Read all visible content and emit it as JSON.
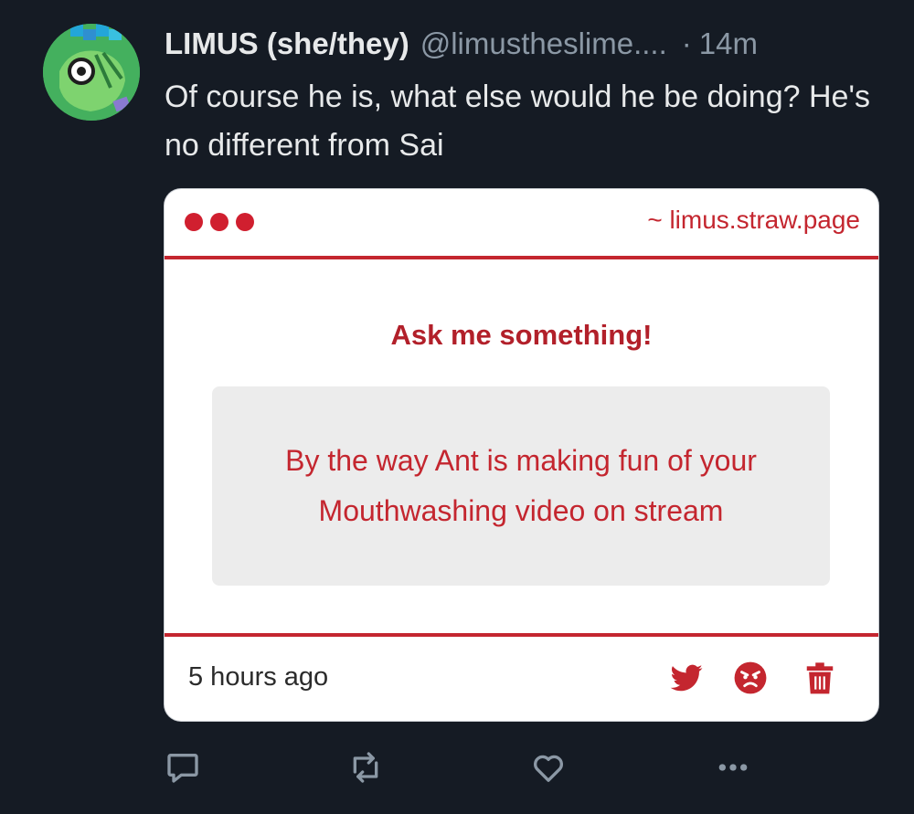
{
  "tweet": {
    "author_name": "LIMUS (she/they)",
    "handle": "@limustheslime....",
    "separator": "·",
    "time": "14m",
    "text": "Of course he is, what else would he be doing? He's no different from Sai"
  },
  "card": {
    "site": "~ limus.straw.page",
    "heading": "Ask me something!",
    "question": "By the way Ant is making fun of your Mouthwashing video on stream",
    "timestamp": "5 hours ago",
    "icons": [
      "twitter-icon",
      "angry-face-icon",
      "trash-icon"
    ],
    "accent_color": "#c4262f"
  },
  "actions": [
    "reply-icon",
    "retweet-icon",
    "like-icon",
    "more-icon"
  ],
  "colors": {
    "background": "#151b24",
    "text": "#e7e9ea",
    "muted": "#8b98a5"
  }
}
